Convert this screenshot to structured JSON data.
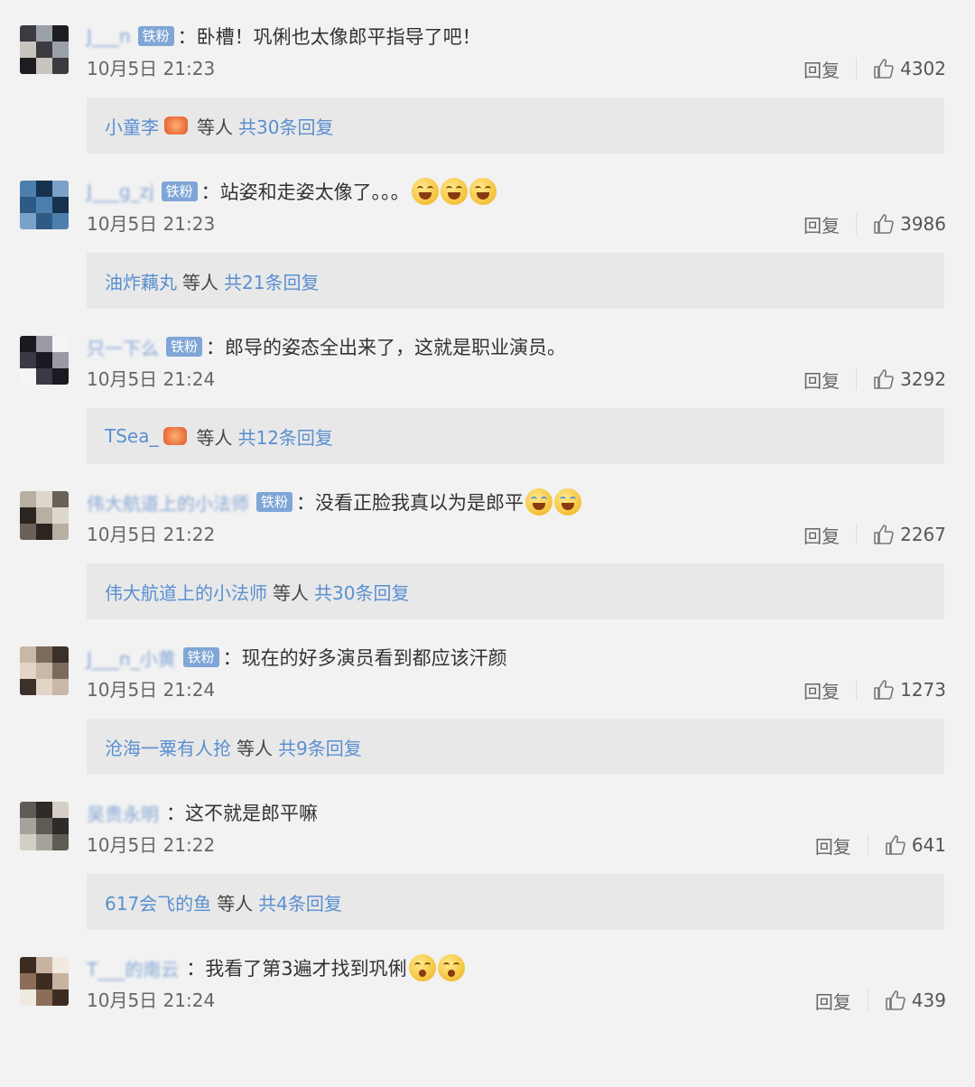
{
  "comments": [
    {
      "username": "J___n",
      "badge": "铁粉",
      "colon": "：",
      "text": "卧槽！巩俐也太像郎平指导了吧！",
      "emojis": [],
      "time": "10月5日 21:23",
      "reply_label": "回复",
      "likes": "4302",
      "reply_user": "小童李",
      "reply_badge": true,
      "reply_mid": "等人",
      "reply_total": "共30条回复"
    },
    {
      "username": "J___g_zj",
      "badge": "铁粉",
      "colon": "：",
      "text": "站姿和走姿太像了。。。",
      "emojis": [
        "laugh",
        "laugh",
        "laugh"
      ],
      "time": "10月5日 21:23",
      "reply_label": "回复",
      "likes": "3986",
      "reply_user": "油炸藕丸",
      "reply_badge": false,
      "reply_mid": "等人",
      "reply_total": "共21条回复"
    },
    {
      "username": "只一下么",
      "badge": "铁粉",
      "colon": "：",
      "text": "郎导的姿态全出来了，这就是职业演员。",
      "emojis": [],
      "time": "10月5日 21:24",
      "reply_label": "回复",
      "likes": "3292",
      "reply_user": "TSea_",
      "reply_badge": true,
      "reply_mid": "等人",
      "reply_total": "共12条回复"
    },
    {
      "username": "伟大航道上的小法师",
      "badge": "铁粉",
      "colon": "：",
      "text": "没看正脸我真以为是郎平",
      "emojis": [
        "tear",
        "tear"
      ],
      "time": "10月5日 21:22",
      "reply_label": "回复",
      "likes": "2267",
      "reply_user": "伟大航道上的小法师",
      "reply_badge": false,
      "reply_mid": "等人",
      "reply_total": "共30条回复"
    },
    {
      "username": "J___n_小黄",
      "badge": "铁粉",
      "colon": "：",
      "text": "现在的好多演员看到都应该汗颜",
      "emojis": [],
      "time": "10月5日 21:24",
      "reply_label": "回复",
      "likes": "1273",
      "reply_user": "沧海一粟有人抢",
      "reply_badge": false,
      "reply_mid": "等人",
      "reply_total": "共9条回复"
    },
    {
      "username": "吴贵永明",
      "badge": "",
      "colon": "：",
      "text": "这不就是郎平嘛",
      "emojis": [],
      "time": "10月5日 21:22",
      "reply_label": "回复",
      "likes": "641",
      "reply_user": "617会飞的鱼",
      "reply_badge": false,
      "reply_mid": "等人",
      "reply_total": "共4条回复"
    },
    {
      "username": "T___的南云",
      "badge": "",
      "colon": "：",
      "text": "我看了第3遍才找到巩俐",
      "emojis": [
        "shock",
        "shock"
      ],
      "time": "10月5日 21:24",
      "reply_label": "回复",
      "likes": "439",
      "reply_user": "",
      "reply_badge": false,
      "reply_mid": "",
      "reply_total": ""
    }
  ],
  "colors": {
    "background": "#f2f2f2",
    "link": "#5a8fd0",
    "badge": "#7fa6d6",
    "reply_bg": "#e8e8e8"
  },
  "icons": [
    "like-icon",
    "emoji-icon",
    "avatar"
  ]
}
